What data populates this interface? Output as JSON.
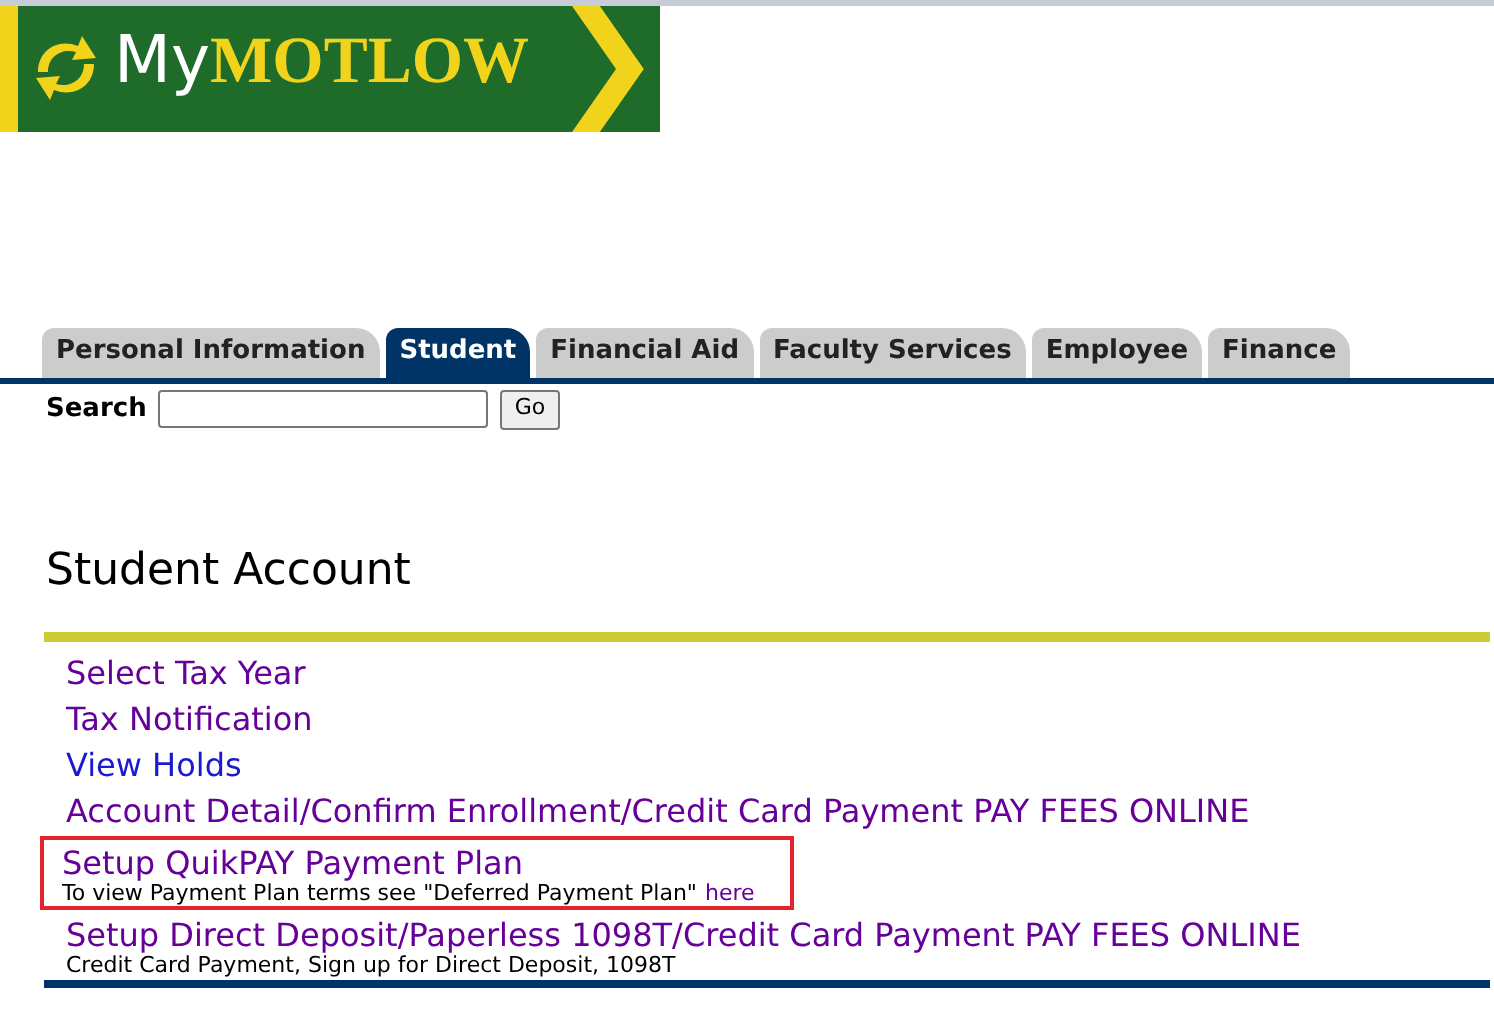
{
  "logo": {
    "prefix": "My",
    "name": "MOTLOW"
  },
  "tabs": [
    {
      "label": "Personal Information",
      "selected": false
    },
    {
      "label": "Student",
      "selected": true
    },
    {
      "label": "Financial Aid",
      "selected": false
    },
    {
      "label": "Faculty Services",
      "selected": false
    },
    {
      "label": "Employee",
      "selected": false
    },
    {
      "label": "Finance",
      "selected": false
    }
  ],
  "search": {
    "label": "Search",
    "button": "Go"
  },
  "page_title": "Student Account",
  "links": [
    {
      "label": "Select Tax Year",
      "visited": true,
      "highlighted": false
    },
    {
      "label": "Tax Notification",
      "visited": true,
      "highlighted": false
    },
    {
      "label": "View Holds",
      "visited": false,
      "highlighted": false
    },
    {
      "label": "Account Detail/Confirm Enrollment/Credit Card Payment PAY FEES ONLINE",
      "visited": true,
      "highlighted": false
    },
    {
      "label": "Setup QuikPAY Payment Plan",
      "visited": true,
      "highlighted": true,
      "description": "To view Payment Plan terms see \"Deferred Payment Plan\"",
      "description_link": "here"
    },
    {
      "label": "Setup Direct Deposit/Paperless 1098T/Credit Card Payment PAY FEES ONLINE",
      "visited": true,
      "highlighted": false,
      "description": "Credit Card Payment, Sign up for Direct Deposit, 1098T"
    }
  ]
}
